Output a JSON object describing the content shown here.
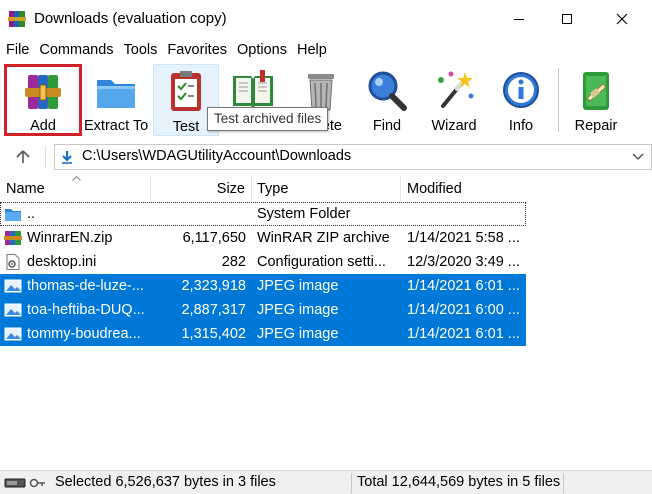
{
  "window": {
    "title": "Downloads (evaluation copy)"
  },
  "menu": [
    "File",
    "Commands",
    "Tools",
    "Favorites",
    "Options",
    "Help"
  ],
  "toolbar": {
    "add": "Add",
    "extract_to": "Extract To",
    "test": "Test",
    "view": "View",
    "delete": "Delete",
    "find": "Find",
    "wizard": "Wizard",
    "info": "Info",
    "repair": "Repair",
    "tooltip": "Test archived files"
  },
  "address": {
    "path": "C:\\Users\\WDAGUtilityAccount\\Downloads"
  },
  "columns": {
    "name": "Name",
    "size": "Size",
    "type": "Type",
    "modified": "Modified"
  },
  "rows": [
    {
      "name": "..",
      "size": "",
      "type": "System Folder",
      "modified": "",
      "icon": "folder-icon",
      "selected": false
    },
    {
      "name": "WinrarEN.zip",
      "size": "6,117,650",
      "type": "WinRAR ZIP archive",
      "modified": "1/14/2021 5:58 ...",
      "icon": "zip-archive-icon",
      "selected": false
    },
    {
      "name": "desktop.ini",
      "size": "282",
      "type": "Configuration setti...",
      "modified": "12/3/2020 3:49 ...",
      "icon": "settings-file-icon",
      "selected": false
    },
    {
      "name": "thomas-de-luze-...",
      "size": "2,323,918",
      "type": "JPEG image",
      "modified": "1/14/2021 6:01 ...",
      "icon": "image-file-icon",
      "selected": true
    },
    {
      "name": "toa-heftiba-DUQ...",
      "size": "2,887,317",
      "type": "JPEG image",
      "modified": "1/14/2021 6:00 ...",
      "icon": "image-file-icon",
      "selected": true
    },
    {
      "name": "tommy-boudrea...",
      "size": "1,315,402",
      "type": "JPEG image",
      "modified": "1/14/2021 6:01 ...",
      "icon": "image-file-icon",
      "selected": true
    }
  ],
  "status": {
    "left": "Selected 6,526,637 bytes in 3 files",
    "right": "Total 12,644,569 bytes in 5 files"
  },
  "colors": {
    "selection": "#0078d7",
    "highlight_border": "#d0202a"
  }
}
